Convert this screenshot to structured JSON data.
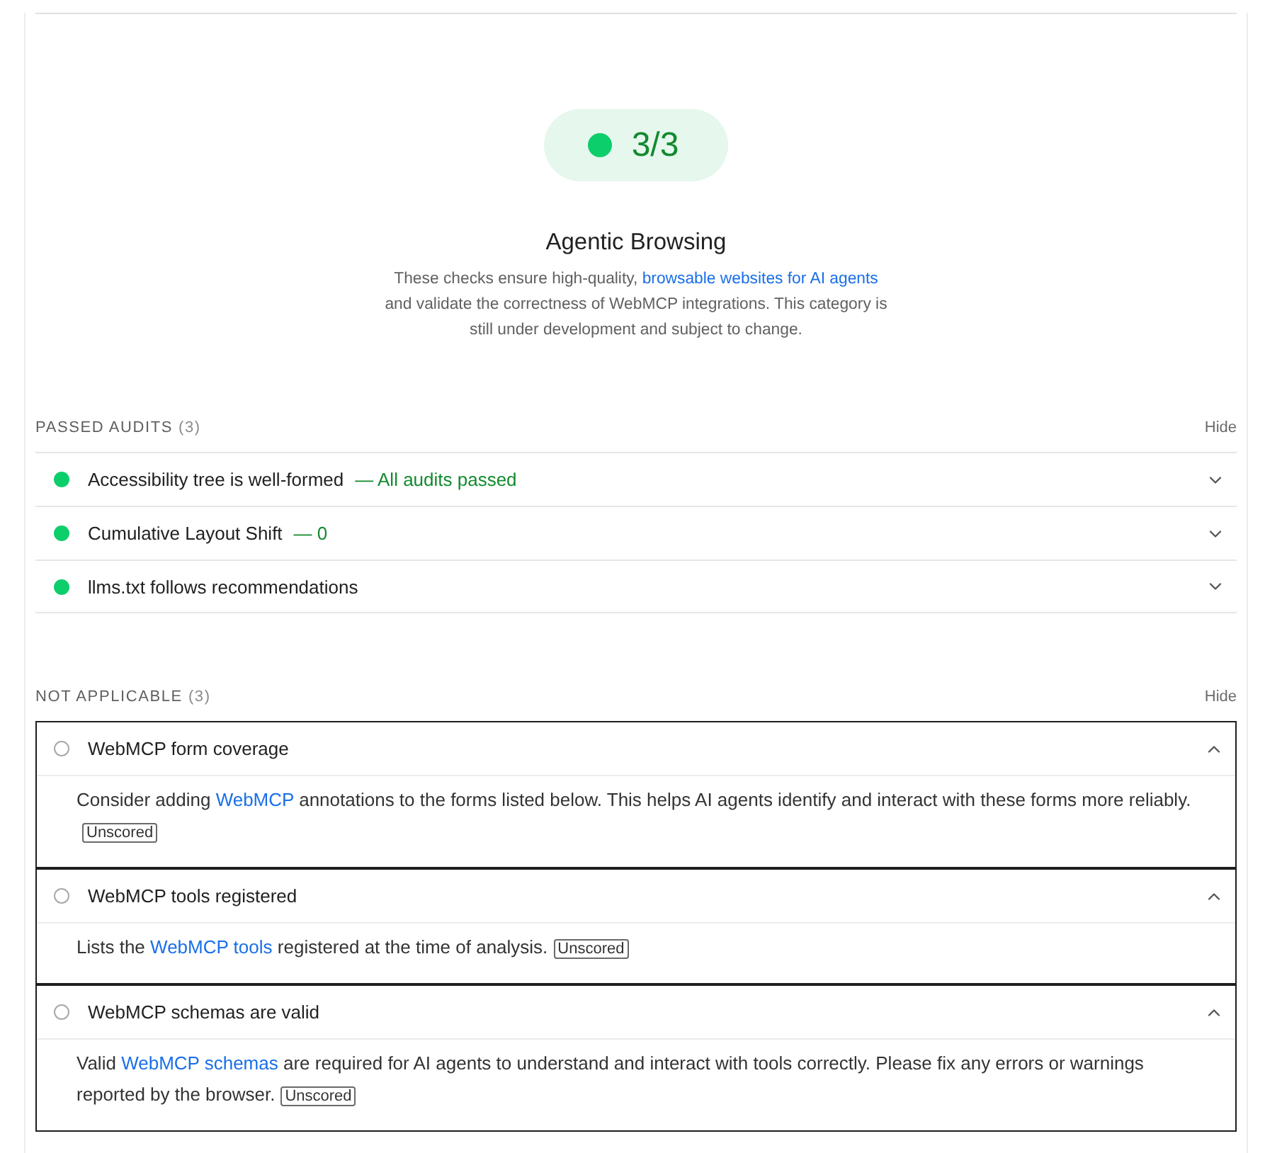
{
  "score": {
    "value": "3/3"
  },
  "category": {
    "title": "Agentic Browsing",
    "description": {
      "before": "These checks ensure high-quality,",
      "link": "browsable websites for AI agents",
      "after": "and validate the correctness of WebMCP integrations. This category is still under development and subject to change."
    }
  },
  "sections": [
    {
      "label": "PASSED AUDITS",
      "count": "(3)",
      "toggle": "Hide",
      "items": [
        {
          "kind": "pass",
          "title": "Accessibility tree is well-formed",
          "display_value": "— All audits passed",
          "expanded": false
        },
        {
          "kind": "pass",
          "title": "Cumulative Layout Shift",
          "display_value": "— 0",
          "expanded": false
        },
        {
          "kind": "pass",
          "title": "llms.txt follows recommendations",
          "expanded": false
        }
      ]
    },
    {
      "label": "NOT APPLICABLE",
      "count": "(3)",
      "toggle": "Hide",
      "items": [
        {
          "kind": "na",
          "title": "WebMCP form coverage",
          "expanded": true,
          "description": {
            "before": "Consider adding",
            "link": "WebMCP",
            "after": "annotations to the forms listed below. This helps AI agents identify and interact with these forms more reliably."
          },
          "badge": "Unscored"
        },
        {
          "kind": "na",
          "title": "WebMCP tools registered",
          "expanded": true,
          "description": {
            "before": "Lists the",
            "link": "WebMCP tools",
            "after": "registered at the time of analysis."
          },
          "badge": "Unscored"
        },
        {
          "kind": "na",
          "title": "WebMCP schemas are valid",
          "expanded": true,
          "description": {
            "before": "Valid",
            "link": "WebMCP schemas",
            "after": "are required for AI agents to understand and interact with tools correctly. Please fix any errors or warnings reported by the browser."
          },
          "badge": "Unscored"
        }
      ]
    }
  ]
}
